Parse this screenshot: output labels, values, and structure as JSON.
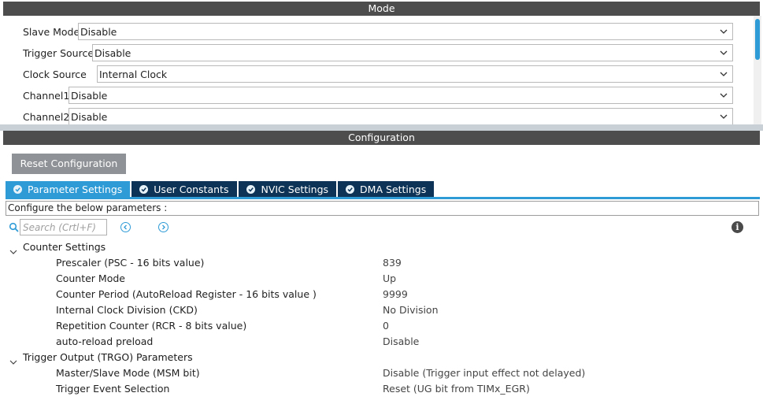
{
  "mode": {
    "title": "Mode",
    "rows": [
      {
        "label": "Slave Mode",
        "value": "Disable"
      },
      {
        "label": "Trigger Source",
        "value": "Disable"
      },
      {
        "label": "Clock Source",
        "value": "Internal Clock"
      },
      {
        "label": "Channel1",
        "value": "Disable"
      },
      {
        "label": "Channel2",
        "value": "Disable"
      }
    ]
  },
  "configuration": {
    "title": "Configuration",
    "reset_label": "Reset Configuration",
    "tabs": [
      {
        "label": "Parameter Settings",
        "active": true
      },
      {
        "label": "User Constants",
        "active": false
      },
      {
        "label": "NVIC Settings",
        "active": false
      },
      {
        "label": "DMA Settings",
        "active": false
      }
    ],
    "instruction": "Configure the below parameters :",
    "search_placeholder": "Search (Crtl+F)",
    "groups": [
      {
        "label": "Counter Settings",
        "params": [
          {
            "name": "Prescaler (PSC - 16 bits value)",
            "value": "839"
          },
          {
            "name": "Counter Mode",
            "value": "Up"
          },
          {
            "name": "Counter Period (AutoReload Register - 16 bits value )",
            "value": "9999"
          },
          {
            "name": "Internal Clock Division (CKD)",
            "value": "No Division"
          },
          {
            "name": "Repetition Counter (RCR - 8 bits value)",
            "value": "0"
          },
          {
            "name": "auto-reload preload",
            "value": "Disable"
          }
        ]
      },
      {
        "label": "Trigger Output (TRGO) Parameters",
        "params": [
          {
            "name": "Master/Slave Mode (MSM bit)",
            "value": "Disable (Trigger input effect not delayed)"
          },
          {
            "name": "Trigger Event Selection",
            "value": "Reset (UG bit from TIMx_EGR)"
          }
        ]
      }
    ]
  },
  "colors": {
    "title_bar": "#4d4d4d",
    "accent": "#2e9bd6",
    "tab_dark": "#0d3456",
    "reset_button": "#8f9296"
  },
  "icons": {
    "dropdown": "chevron-down-icon",
    "tab_check": "check-circle-icon",
    "search": "search-icon",
    "prev": "arrow-left-circle-icon",
    "next": "arrow-right-circle-icon",
    "info": "info-icon",
    "tree_toggle": "chevron-down-icon"
  },
  "info_glyph": "i"
}
